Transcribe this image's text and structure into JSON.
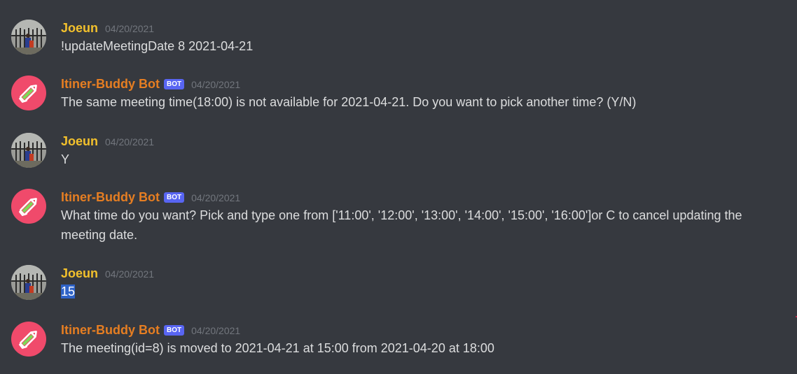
{
  "messages": [
    {
      "author": "Joeun",
      "is_bot": false,
      "timestamp": "04/20/2021",
      "content": "!updateMeetingDate 8 2021-04-21"
    },
    {
      "author": "Itiner-Buddy Bot",
      "is_bot": true,
      "bot_tag": "BOT",
      "timestamp": "04/20/2021",
      "content": "The same meeting time(18:00) is not available for 2021-04-21. Do you want to pick another time? (Y/N)"
    },
    {
      "author": "Joeun",
      "is_bot": false,
      "timestamp": "04/20/2021",
      "content": "Y"
    },
    {
      "author": "Itiner-Buddy Bot",
      "is_bot": true,
      "bot_tag": "BOT",
      "timestamp": "04/20/2021",
      "content": "What time do you want? Pick and type one from ['11:00', '12:00', '13:00', '14:00', '15:00', '16:00']or C to cancel updating the meeting date."
    },
    {
      "author": "Joeun",
      "is_bot": false,
      "timestamp": "04/20/2021",
      "content": "15",
      "content_selected": true
    },
    {
      "author": "Itiner-Buddy Bot",
      "is_bot": true,
      "bot_tag": "BOT",
      "timestamp": "04/20/2021",
      "content": "The meeting(id=8) is moved to 2021-04-21 at 15:00 from 2021-04-20 at 18:00"
    }
  ],
  "colors": {
    "background": "#36393f",
    "user_name": "#f3c12c",
    "bot_name": "#e67e22",
    "bot_tag": "#5865f2",
    "bot_avatar": "#f04a6b",
    "timestamp": "#72767d",
    "text": "#dcddde",
    "selection": "#2f63c7"
  },
  "icons": {
    "user_avatar": "user-photo-avatar",
    "bot_avatar": "pencil-icon"
  }
}
